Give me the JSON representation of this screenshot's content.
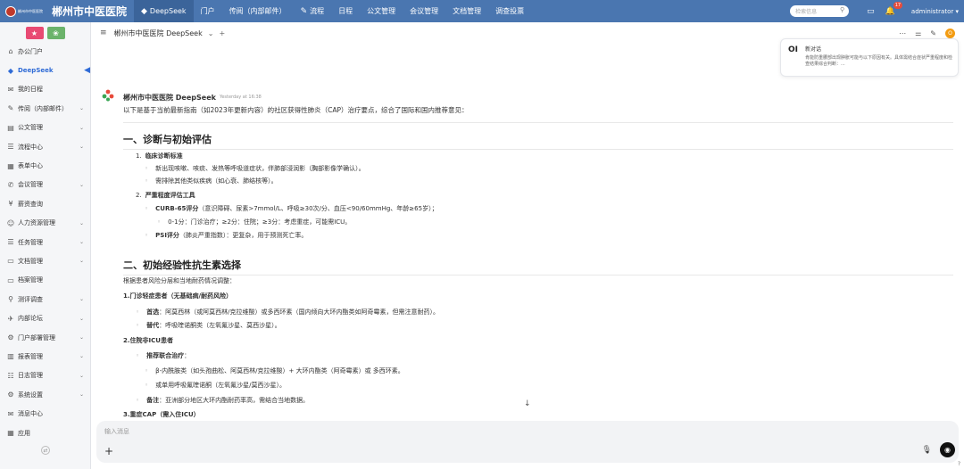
{
  "topbar": {
    "logo_small": "郴州市中医医院",
    "logo_title": "郴州市中医医院",
    "nav": [
      {
        "icon": "◆",
        "label": "DeepSeek",
        "active": true
      },
      {
        "icon": "",
        "label": "门户"
      },
      {
        "icon": "",
        "label": "传阅（内部邮件）"
      },
      {
        "icon": "✎",
        "label": "流程"
      },
      {
        "icon": "",
        "label": "日程"
      },
      {
        "icon": "",
        "label": "公文管理"
      },
      {
        "icon": "",
        "label": "会议管理"
      },
      {
        "icon": "",
        "label": "文档管理"
      },
      {
        "icon": "",
        "label": "调查投票"
      }
    ],
    "search_placeholder": "检索信息",
    "notification_count": "17",
    "user": "administrator ▾"
  },
  "sidebar": {
    "items": [
      {
        "icon": "⌂",
        "label": "办公门户",
        "arrow": false
      },
      {
        "icon": "◆",
        "label": "DeepSeek",
        "arrow": false,
        "active": true
      },
      {
        "icon": "✉",
        "label": "我的日程",
        "arrow": false
      },
      {
        "icon": "✎",
        "label": "传阅（内部邮件）",
        "arrow": true
      },
      {
        "icon": "▤",
        "label": "公文管理",
        "arrow": true
      },
      {
        "icon": "☰",
        "label": "流程中心",
        "arrow": true
      },
      {
        "icon": "▦",
        "label": "表单中心",
        "arrow": false
      },
      {
        "icon": "✆",
        "label": "会议管理",
        "arrow": true
      },
      {
        "icon": "¥",
        "label": "薪资查询",
        "arrow": false
      },
      {
        "icon": "☺",
        "label": "人力资源管理",
        "arrow": true
      },
      {
        "icon": "☰",
        "label": "任务管理",
        "arrow": true
      },
      {
        "icon": "▭",
        "label": "文档管理",
        "arrow": true
      },
      {
        "icon": "▭",
        "label": "档案管理",
        "arrow": false
      },
      {
        "icon": "⚲",
        "label": "测评调查",
        "arrow": true
      },
      {
        "icon": "✈",
        "label": "内部论坛",
        "arrow": true
      },
      {
        "icon": "⚙",
        "label": "门户部署管理",
        "arrow": true
      },
      {
        "icon": "▥",
        "label": "报表管理",
        "arrow": true
      },
      {
        "icon": "☷",
        "label": "日志管理",
        "arrow": true
      },
      {
        "icon": "⚙",
        "label": "系统设置",
        "arrow": true
      },
      {
        "icon": "✉",
        "label": "消息中心",
        "arrow": false
      },
      {
        "icon": "▦",
        "label": "应用",
        "arrow": false
      }
    ]
  },
  "main": {
    "title": "郴州市中医医院 DeepSeek",
    "notice": {
      "title": "新对话",
      "body": "肯能防重腰部出现肿胀可能与以下原因有关。具体需结合症状严重程度和检查结果综合判断：..."
    },
    "bot_name": "郴州市中医医院 DeepSeek",
    "time": "Yesterday at 16:38",
    "intro": "以下是基于当前最新指南（如2023年更新内容）的社区获得性肺炎（CAP）治疗要点，综合了国际和国内推荐意见：",
    "sections": [
      {
        "title": "一、诊断与初始评估"
      },
      {
        "title": "二、初始经验性抗生素选择"
      }
    ],
    "lines": [
      {
        "indent": 1,
        "num": "1.",
        "bold": "临床诊断标准",
        "text": ""
      },
      {
        "indent": 2,
        "bullet": "◦",
        "text": "新出现咳嗽、咳痰、发热等呼吸道症状，伴肺部浸润影（胸部影像学确认）。"
      },
      {
        "indent": 2,
        "bullet": "◦",
        "text": "需排除其他类似疾病（如心衰、肺结核等）。"
      },
      {
        "indent": 1,
        "num": "2.",
        "bold": "严重程度评估工具",
        "text": ""
      },
      {
        "indent": 2,
        "bullet": "◦",
        "bold": "CURB-65评分",
        "text": "（意识障碍、尿素>7mmol/L、呼吸≥30次/分、血压<90/60mmHg、年龄≥65岁）；"
      },
      {
        "indent": 3,
        "bullet": "◦",
        "text": "0-1分：门诊治疗；≥2分：住院；≥3分：考虑重症，可能需ICU。"
      },
      {
        "indent": 2,
        "bullet": "◦",
        "bold": "PSI评分",
        "text": "（肺炎严重指数）：更复杂，用于预测死亡率。"
      },
      {
        "indent": 0,
        "text": "根据患者风险分层和当地耐药情况调整："
      },
      {
        "indent": 0,
        "bold": "1.门诊轻症患者（无基础病/耐药风险）",
        "text": ""
      },
      {
        "indent": 1,
        "bullet": "◦",
        "bold": "首选",
        "text": "：阿莫西林（或阿莫西林/克拉维酸）或多西环素（国内倾向大环内酯类如阿奇霉素，但需注意耐药）。"
      },
      {
        "indent": 1,
        "bullet": "◦",
        "bold": "替代",
        "text": "：呼吸喹诺酮类（左氧氟沙星、莫西沙星）。"
      },
      {
        "indent": 0,
        "bold": "2.住院非ICU患者",
        "text": ""
      },
      {
        "indent": 1,
        "bullet": "◦",
        "bold": "推荐联合治疗",
        "text": "："
      },
      {
        "indent": 2,
        "bullet": "◦",
        "text": "β-内酰胺类（如头孢曲松、阿莫西林/克拉维酸）+ 大环内酯类（阿奇霉素）或 多西环素。"
      },
      {
        "indent": 2,
        "bullet": "◦",
        "text": "或单用呼吸氟喹诺酮（左氧氟沙星/莫西沙星）。"
      },
      {
        "indent": 1,
        "bullet": "◦",
        "bold": "备注",
        "text": "：亚洲部分地区大环内酯耐药率高，需结合当地数据。"
      },
      {
        "indent": 0,
        "bold": "3.重症CAP（需入住ICU）",
        "text": ""
      }
    ],
    "input_placeholder": "输入消息",
    "help": "?"
  },
  "colors": {
    "topbar": "#4a76b0",
    "accent": "#2f6bd6",
    "pink_btn": "#e84a73",
    "green_btn": "#6bb36b"
  }
}
